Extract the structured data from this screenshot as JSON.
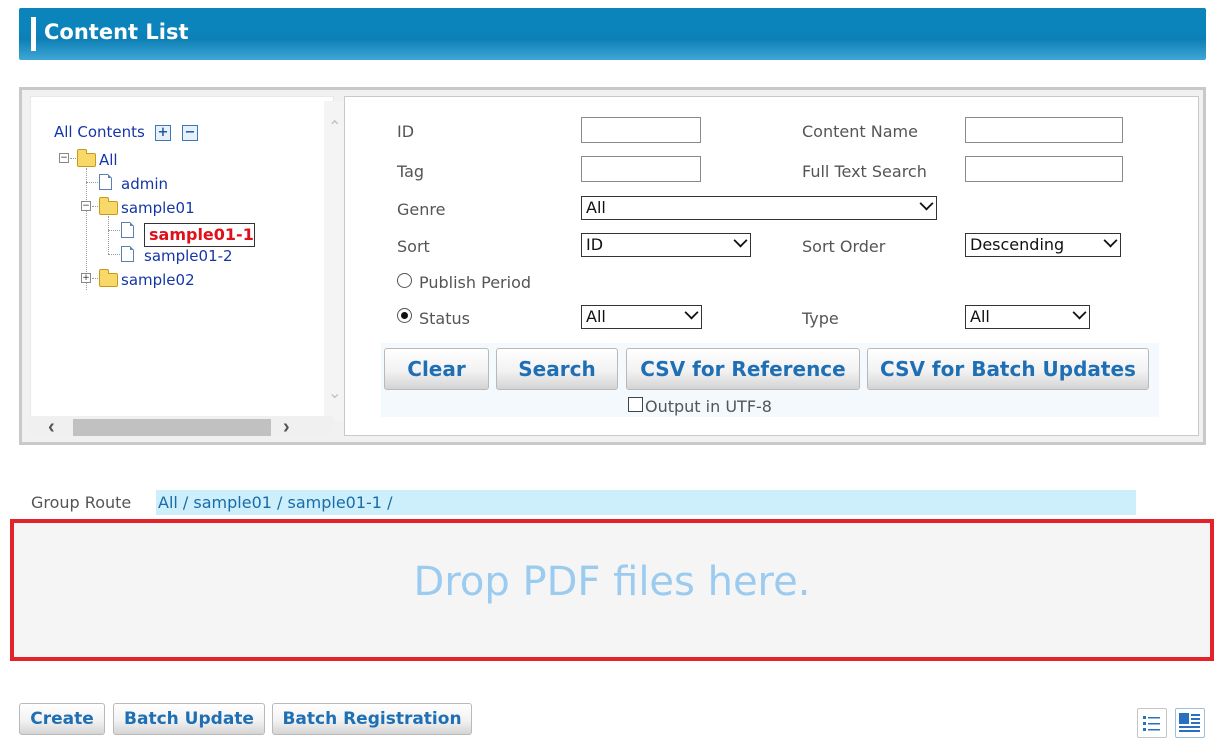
{
  "header": {
    "title": "Content List"
  },
  "tree": {
    "all_contents_label": "All Contents",
    "expand_all_symbol": "+",
    "collapse_all_symbol": "−",
    "nodes": [
      {
        "label": "All",
        "type": "folder",
        "state": "expanded"
      },
      {
        "label": "admin",
        "type": "document"
      },
      {
        "label": "sample01",
        "type": "folder",
        "state": "expanded"
      },
      {
        "label": "sample01-1",
        "type": "document",
        "selected": true
      },
      {
        "label": "sample01-2",
        "type": "document"
      },
      {
        "label": "sample02",
        "type": "folder",
        "state": "collapsed"
      }
    ]
  },
  "search": {
    "id_label": "ID",
    "id_value": "",
    "content_name_label": "Content Name",
    "content_name_value": "",
    "tag_label": "Tag",
    "tag_value": "",
    "full_text_label": "Full Text Search",
    "full_text_value": "",
    "genre_label": "Genre",
    "genre_value": "All",
    "sort_label": "Sort",
    "sort_value": "ID",
    "sort_order_label": "Sort Order",
    "sort_order_value": "Descending",
    "publish_period_label": "Publish Period",
    "status_label": "Status",
    "status_value": "All",
    "type_label": "Type",
    "type_value": "All",
    "status_radio_selected": true
  },
  "actions": {
    "clear": "Clear",
    "search": "Search",
    "csv_reference": "CSV for Reference",
    "csv_batch": "CSV for Batch Updates",
    "utf8_label": "Output in UTF-8",
    "utf8_checked": false
  },
  "group_route": {
    "label": "Group Route",
    "value": "All / sample01 / sample01-1 /"
  },
  "dropzone": {
    "text": "Drop PDF files here."
  },
  "bottom": {
    "create": "Create",
    "batch_update": "Batch Update",
    "batch_registration": "Batch Registration",
    "view_list": "list-view-icon",
    "view_detail": "detail-view-icon"
  },
  "colors": {
    "header": "#0a84bb",
    "accent_text": "#1f6fb5",
    "selected_node": "#e0101a",
    "drop_border": "#e3222a"
  }
}
